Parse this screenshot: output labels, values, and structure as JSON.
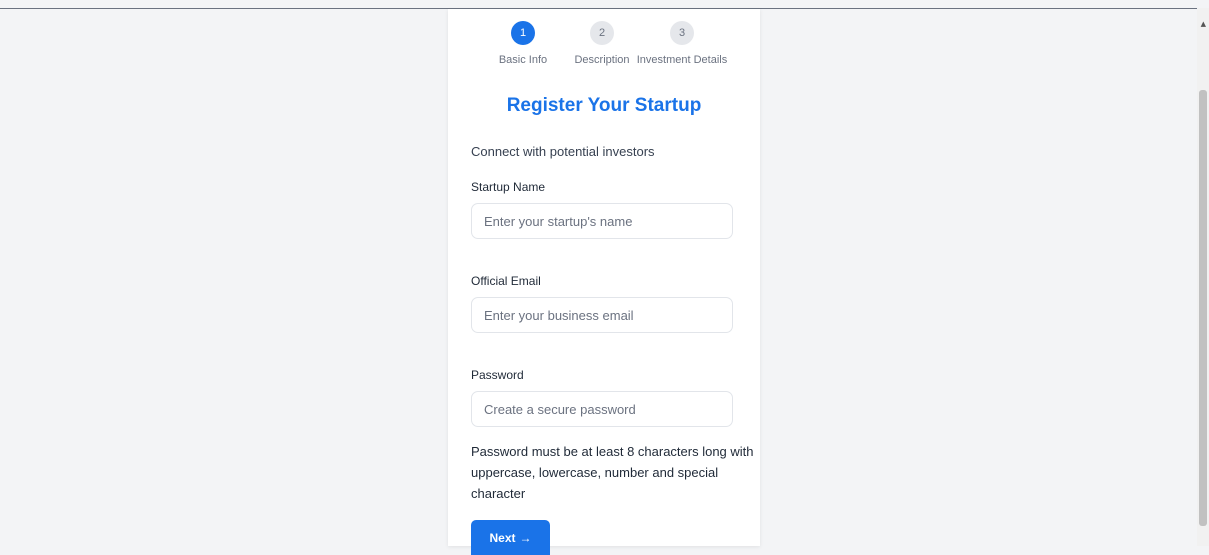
{
  "steps": [
    {
      "number": "1",
      "label": "Basic Info",
      "state": "active"
    },
    {
      "number": "2",
      "label": "Description",
      "state": "inactive"
    },
    {
      "number": "3",
      "label": "Investment Details",
      "state": "inactive"
    }
  ],
  "form": {
    "title": "Register Your Startup",
    "subtitle": "Connect with potential investors",
    "startup_name": {
      "label": "Startup Name",
      "placeholder": "Enter your startup's name",
      "value": ""
    },
    "email": {
      "label": "Official Email",
      "placeholder": "Enter your business email",
      "value": ""
    },
    "password": {
      "label": "Password",
      "placeholder": "Create a secure password",
      "value": ""
    },
    "password_hint": "Password must be at least 8 characters long with uppercase, lowercase, number and special character",
    "next_label": "Next",
    "next_arrow": "→"
  },
  "colors": {
    "accent": "#1a73e8",
    "background": "#f3f4f6",
    "step_inactive": "#e5e7eb"
  }
}
